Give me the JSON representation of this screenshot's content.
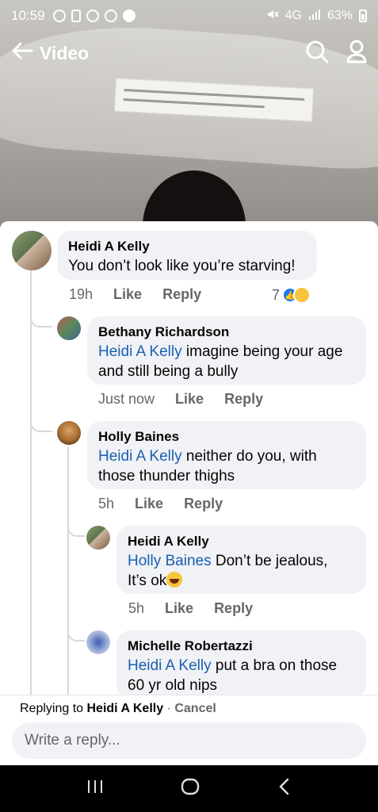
{
  "status_bar": {
    "time": "10:59",
    "network": "4G",
    "battery": "63%"
  },
  "topnav": {
    "title": "Video"
  },
  "comments": [
    {
      "author": "Heidi A Kelly",
      "text": "You don’t look like you’re starving!",
      "time": "19h",
      "like": "Like",
      "reply": "Reply",
      "reaction_count": "7"
    },
    {
      "author": "Bethany Richardson",
      "mention": "Heidi A Kelly",
      "text_line1": " imagine being your age",
      "text_line2": "and still being a bully",
      "time": "Just now",
      "like": "Like",
      "reply": "Reply"
    },
    {
      "author": "Holly Baines",
      "mention": "Heidi A Kelly",
      "text_line1": " neither do you, with",
      "text_line2": "those thunder thighs",
      "time": "5h",
      "like": "Like",
      "reply": "Reply"
    },
    {
      "author": "Heidi A Kelly",
      "mention": "Holly Baines",
      "text_line1": " Don’t be jealous,",
      "text_line2": "It’s ok",
      "time": "5h",
      "like": "Like",
      "reply": "Reply"
    },
    {
      "author": "Michelle Robertazzi",
      "mention": "Heidi A Kelly",
      "text_line1": " put a bra on those",
      "text_line2": "60 yr old nips"
    }
  ],
  "composer": {
    "replying_prefix": "Replying to ",
    "replying_name": "Heidi A Kelly",
    "separator": " · ",
    "cancel": "Cancel",
    "placeholder": "Write a reply..."
  },
  "icons": {
    "back": "arrow-left-icon",
    "search": "search-icon",
    "profile": "person-icon",
    "recents": "recent-apps-icon",
    "home": "home-icon",
    "nav_back": "chevron-left-icon"
  }
}
